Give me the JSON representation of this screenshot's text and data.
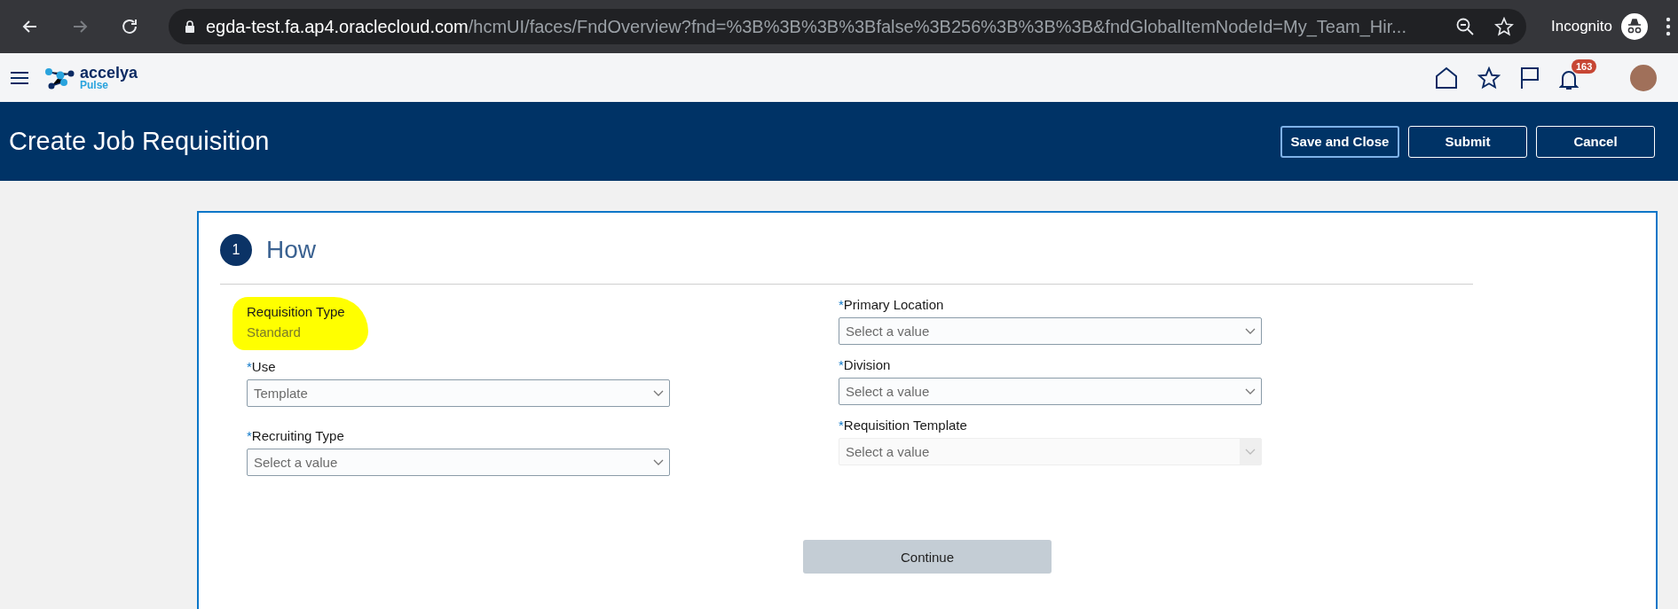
{
  "browser": {
    "nav": [
      {
        "kind": "back",
        "disabled": false
      },
      {
        "kind": "forward",
        "disabled": true
      },
      {
        "kind": "reload",
        "disabled": false
      }
    ],
    "url_host": "egda-test.fa.ap4.oraclecloud.com",
    "url_path": "/hcmUI/faces/FndOverview?fnd=%3B%3B%3B%3Bfalse%3B256%3B%3B%3B&fndGlobalItemNodeId=My_Team_Hir...",
    "profile_label": "Incognito"
  },
  "app_header": {
    "logo": {
      "name": "accelya",
      "product": "Pulse"
    },
    "notifications_badge": "163"
  },
  "page_header": {
    "title": "Create Job Requisition",
    "buttons": [
      {
        "label": "Save and Close",
        "focused": true
      },
      {
        "label": "Submit",
        "focused": false
      },
      {
        "label": "Cancel",
        "focused": false
      }
    ]
  },
  "step": {
    "number": "1",
    "title": "How"
  },
  "info": {
    "label": "Requisition Type",
    "value": "Standard",
    "highlighted": true
  },
  "left_fields": [
    {
      "marker": "*",
      "label": "Use",
      "value": "Template",
      "disabled": false
    },
    {
      "marker": "*",
      "label": "Recruiting Type",
      "placeholder": "Select a value",
      "disabled": false
    }
  ],
  "right_fields": [
    {
      "marker": "*",
      "label": "Primary Location",
      "placeholder": "Select a value",
      "disabled": false
    },
    {
      "marker": "*",
      "label": "Division",
      "placeholder": "Select a value",
      "disabled": false
    },
    {
      "marker": "*",
      "label": "Requisition Template",
      "placeholder": "Select a value",
      "disabled": true
    }
  ],
  "continue_button": {
    "label": "Continue"
  }
}
